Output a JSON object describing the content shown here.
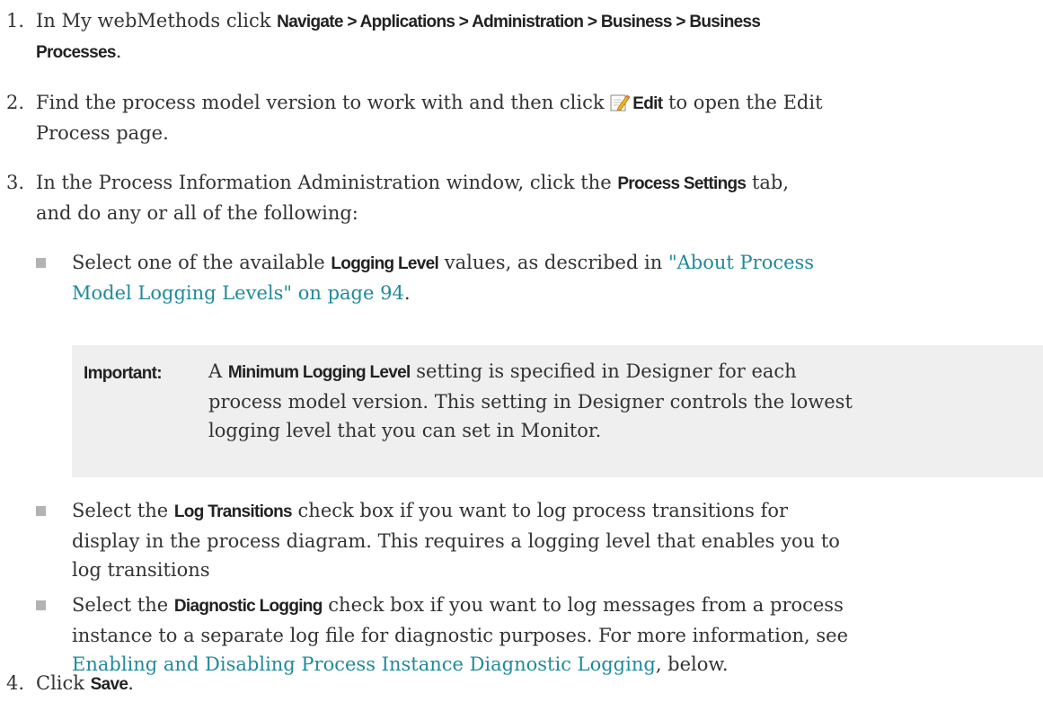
{
  "steps": [
    {
      "number": "1.",
      "prefix": "In My webMethods click ",
      "path": "Navigate > Applications > Administration > Business > Business",
      "path_cont": "Processes",
      "suffix": "."
    },
    {
      "number": "2.",
      "prefix": "Find the process model version to work with and then click ",
      "button_label": "Edit",
      "suffix_line1": " to open the Edit",
      "suffix_line2": "Process page."
    },
    {
      "number": "3.",
      "line1_prefix": "In the Process Information Administration window, click the ",
      "tab_label": "Process Settings",
      "line1_suffix": " tab,",
      "line2": "and do any or all of the following:",
      "bullets": [
        {
          "prefix": "Select one of the available ",
          "ui": "Logging Level",
          "middle": " values, as described in ",
          "link_line1": "\"About Process",
          "link_line2": "Model Logging Levels\" on page 94",
          "suffix": "."
        },
        {
          "prefix": "Select the ",
          "ui": "Log Transitions",
          "line1_suffix": " check box if you want to log process transitions for",
          "line2": "display in the process diagram. This requires a logging level that enables you to",
          "line3": "log transitions"
        },
        {
          "prefix": "Select the ",
          "ui": "Diagnostic Logging",
          "line1_suffix": " check box if you want to log messages from a process",
          "line2": "instance to a separate log file for diagnostic purposes. For more information, see",
          "link": "Enabling and Disabling Process Instance Diagnostic Logging",
          "suffix": ", below."
        }
      ],
      "note": {
        "label": "Important:",
        "prefix": " A ",
        "ui": "Minimum Logging Level",
        "line1_suffix": " setting is specified in Designer for each",
        "line2": "process model version. This setting in Designer controls the lowest",
        "line3": "logging level that you can set in Monitor."
      }
    },
    {
      "number": "4.",
      "prefix": "Click ",
      "button_label": "Save",
      "suffix": "."
    }
  ],
  "colors": {
    "link": "#1f8a9c",
    "note_bg": "#efefef",
    "bullet": "#b3b3b3"
  },
  "icons": [
    "edit-icon"
  ]
}
